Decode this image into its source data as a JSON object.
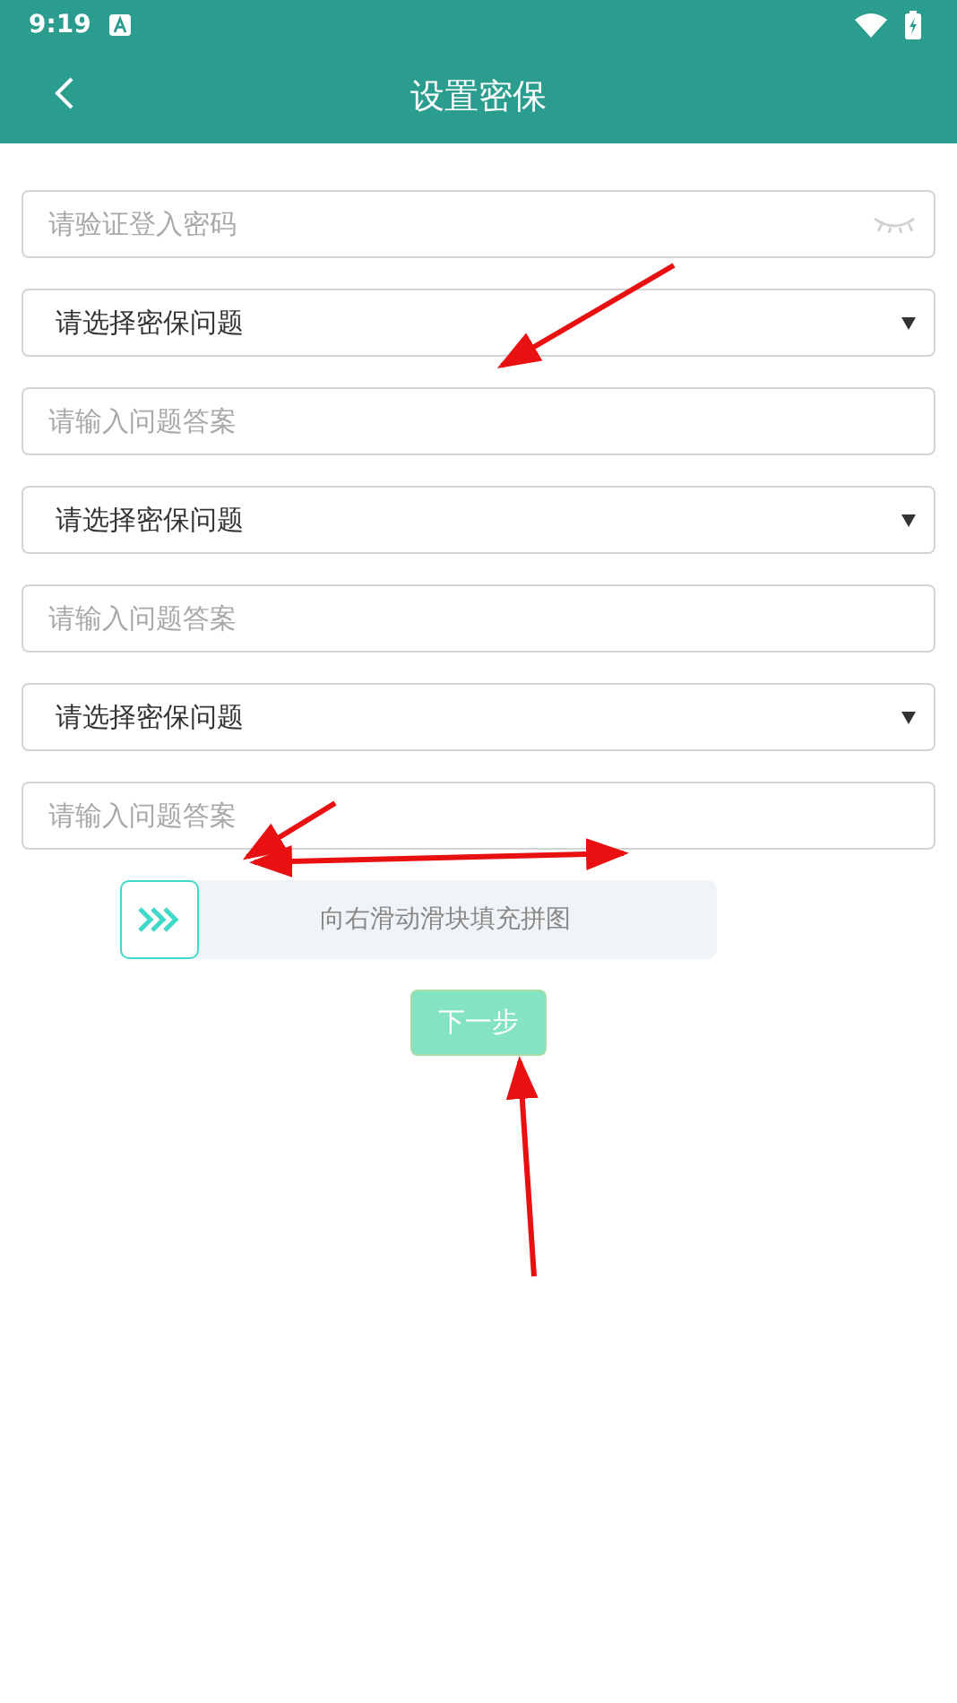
{
  "status_bar": {
    "time": "9:19"
  },
  "header": {
    "title": "设置密保"
  },
  "fields": [
    {
      "kind": "password",
      "placeholder": "请验证登入密码"
    },
    {
      "kind": "select",
      "value": "请选择密保问题"
    },
    {
      "kind": "answer",
      "placeholder": "请输入问题答案"
    },
    {
      "kind": "select",
      "value": "请选择密保问题"
    },
    {
      "kind": "answer",
      "placeholder": "请输入问题答案"
    },
    {
      "kind": "select",
      "value": "请选择密保问题"
    },
    {
      "kind": "answer",
      "placeholder": "请输入问题答案"
    }
  ],
  "slider": {
    "label": "向右滑动滑块填充拼图",
    "level": 0
  },
  "next_button": {
    "label": "下一步",
    "disabled": true
  }
}
